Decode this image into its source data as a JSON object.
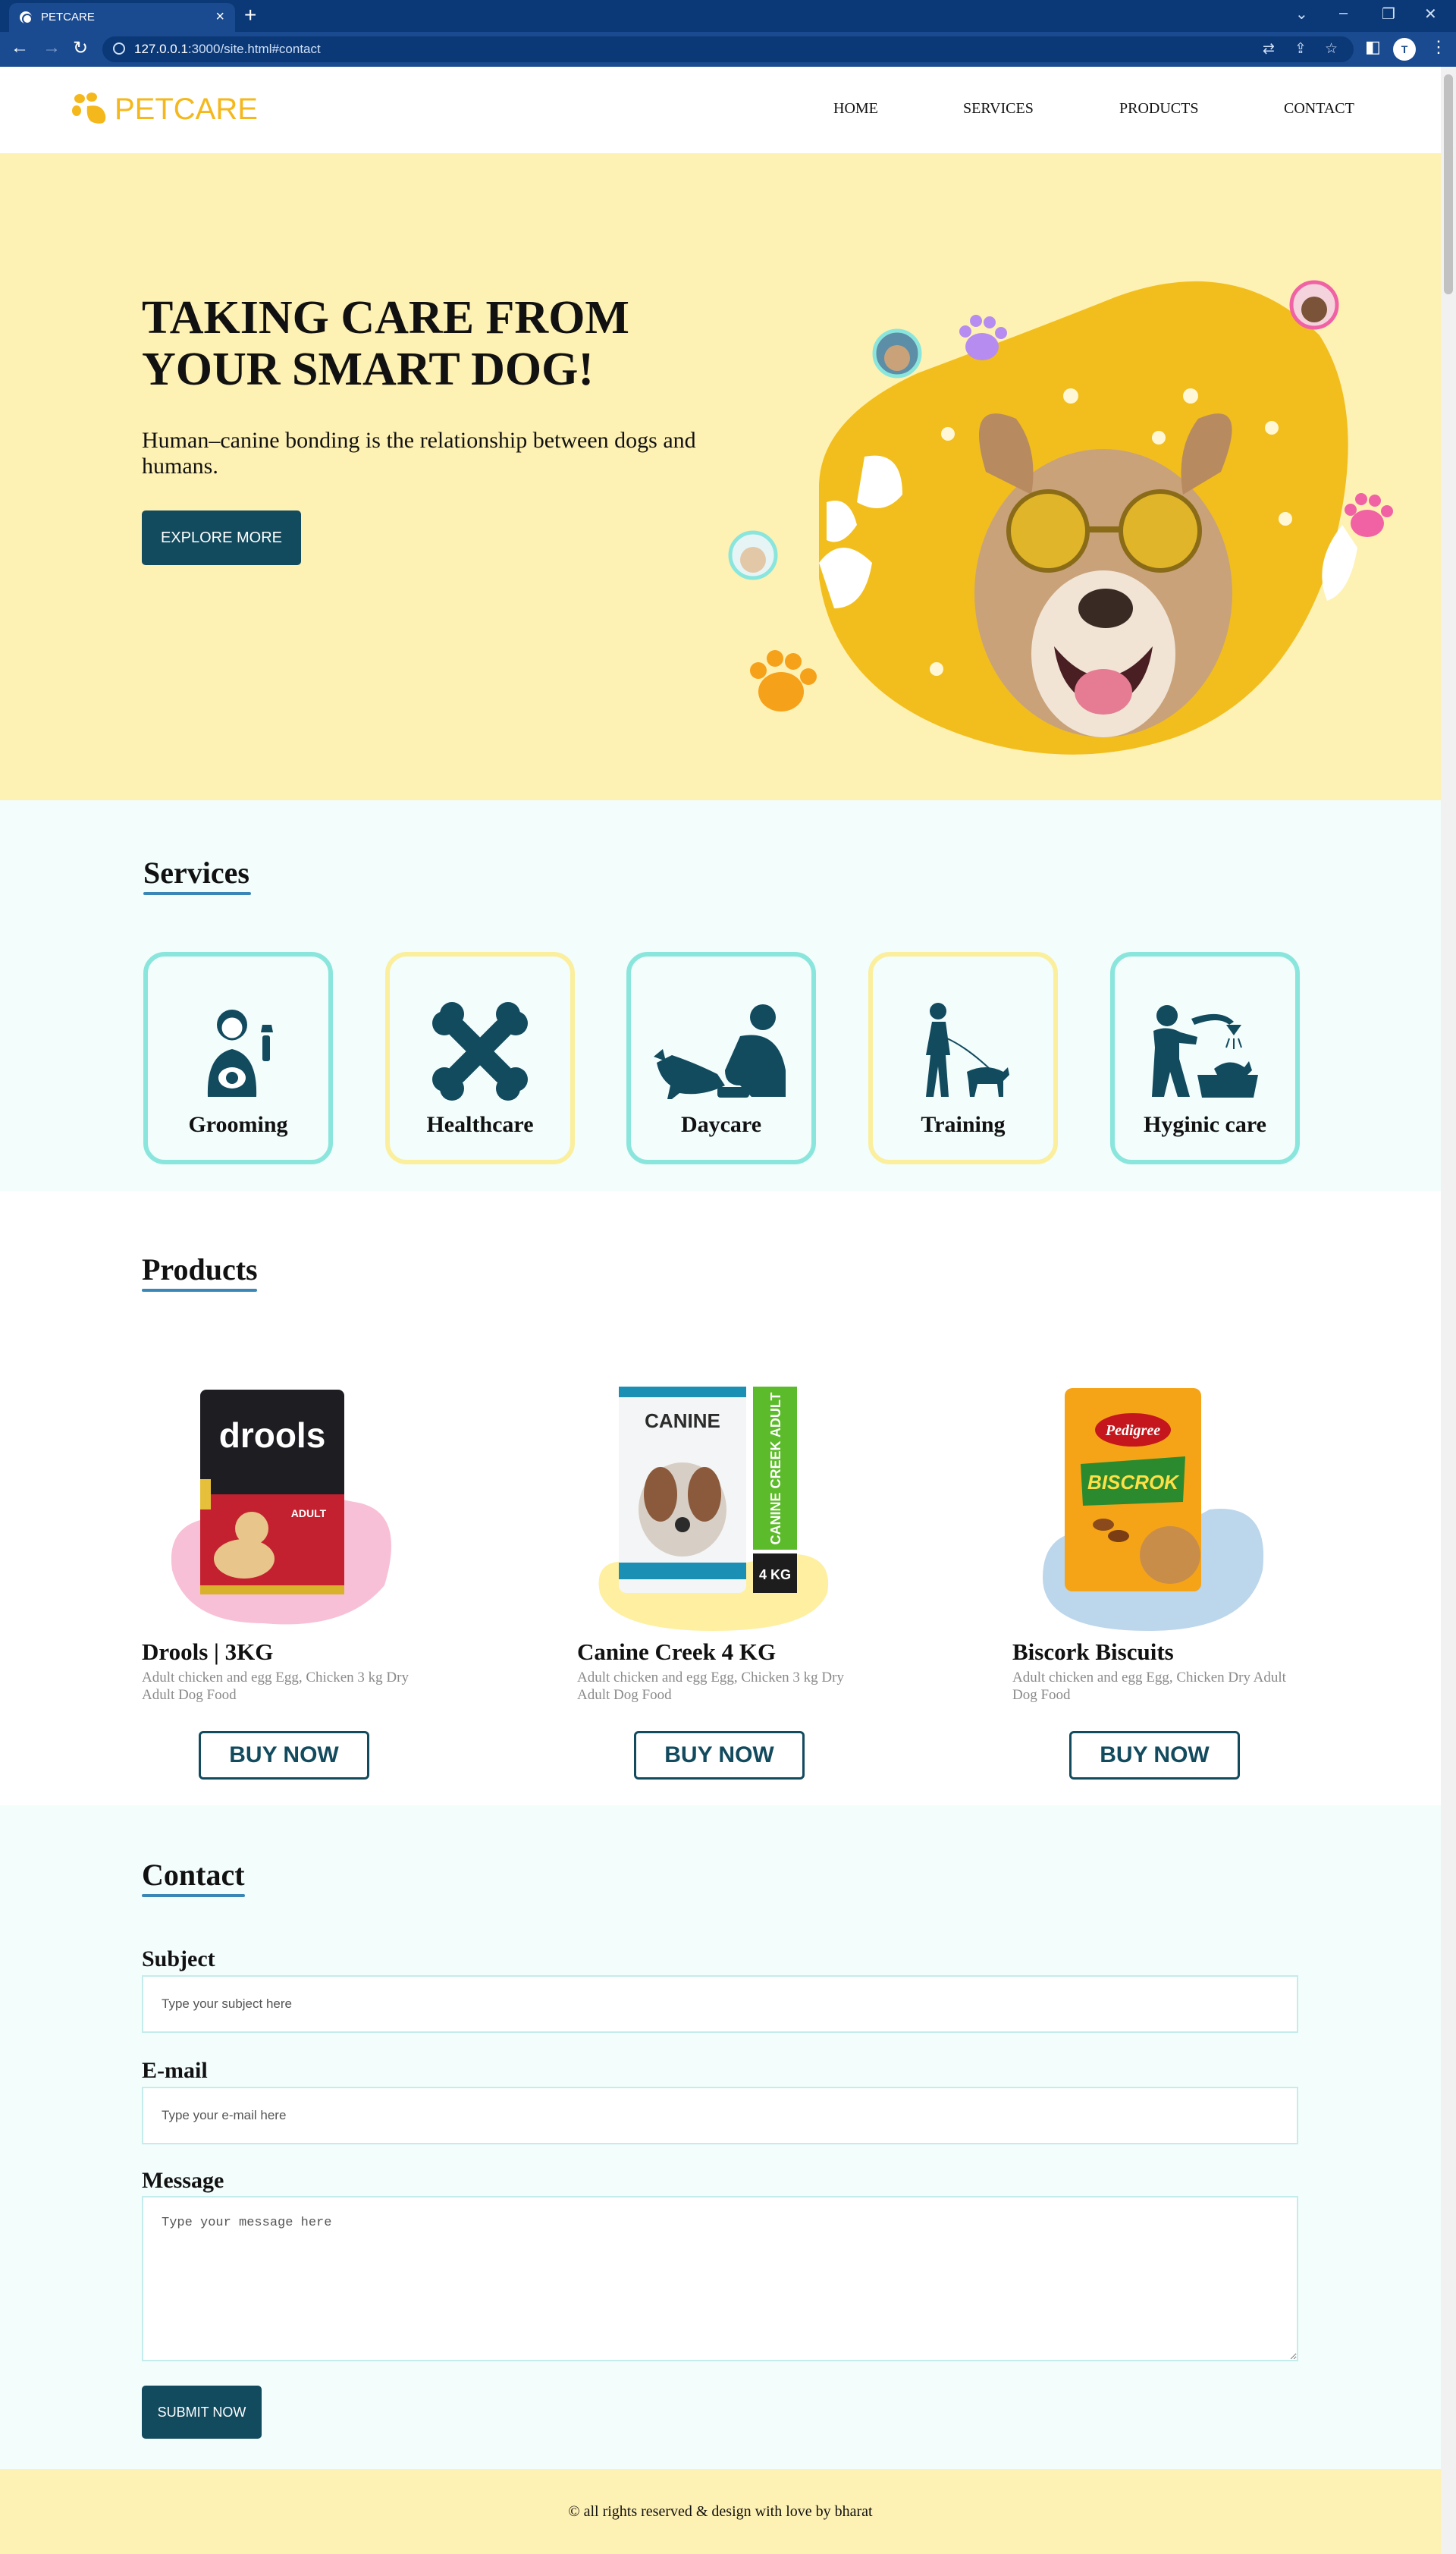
{
  "browser": {
    "tab_title": "PETCARE",
    "url_host": "127.0.0.1",
    "url_rest": ":3000/site.html#contact",
    "profile_initial": "T"
  },
  "brand": {
    "logo_part1": "PET",
    "logo_part2": "CARE",
    "color": "#f5b81c"
  },
  "nav": [
    {
      "label": "HOME"
    },
    {
      "label": "SERVICES"
    },
    {
      "label": "PRODUCTS"
    },
    {
      "label": "CONTACT"
    }
  ],
  "hero": {
    "title_line1": "TAKING CARE FROM",
    "title_line2": "YOUR SMART DOG!",
    "subtitle": "Human–canine bonding is the relationship between dogs and humans.",
    "cta_label": "EXPLORE MORE"
  },
  "services": {
    "title": "Services",
    "items": [
      {
        "label": "Grooming",
        "icon": "groomer-icon"
      },
      {
        "label": "Healthcare",
        "icon": "bone-icon"
      },
      {
        "label": "Daycare",
        "icon": "feeding-dog-icon"
      },
      {
        "label": "Training",
        "icon": "dog-walking-icon"
      },
      {
        "label": "Hyginic care",
        "icon": "dog-bath-icon"
      }
    ]
  },
  "products": {
    "title": "Products",
    "items": [
      {
        "name": "Drools | 3KG",
        "desc": "Adult chicken and egg Egg, Chicken 3 kg Dry Adult Dog Food",
        "button": "BUY NOW",
        "pack_brand": "drools",
        "pack_label": "ADULT"
      },
      {
        "name": "Canine Creek 4 KG",
        "desc": "Adult chicken and egg Egg, Chicken 3 kg Dry Adult Dog Food",
        "button": "BUY NOW",
        "pack_brand": "CANINE",
        "pack_side": "CANINE CREEK ADULT",
        "pack_weight": "4 KG"
      },
      {
        "name": "Biscork Biscuits",
        "desc": "Adult chicken and egg Egg, Chicken Dry Adult Dog Food",
        "button": "BUY NOW",
        "pack_brand": "Pedigree",
        "pack_label": "BISCROK"
      }
    ]
  },
  "contact": {
    "title": "Contact",
    "subject_label": "Subject",
    "subject_placeholder": "Type your subject here",
    "email_label": "E-mail",
    "email_placeholder": "Type your e-mail here",
    "message_label": "Message",
    "message_placeholder": "Type your message here",
    "submit_label": "SUBMIT NOW"
  },
  "footer": {
    "text": "© all rights reserved & design with love by bharat"
  }
}
